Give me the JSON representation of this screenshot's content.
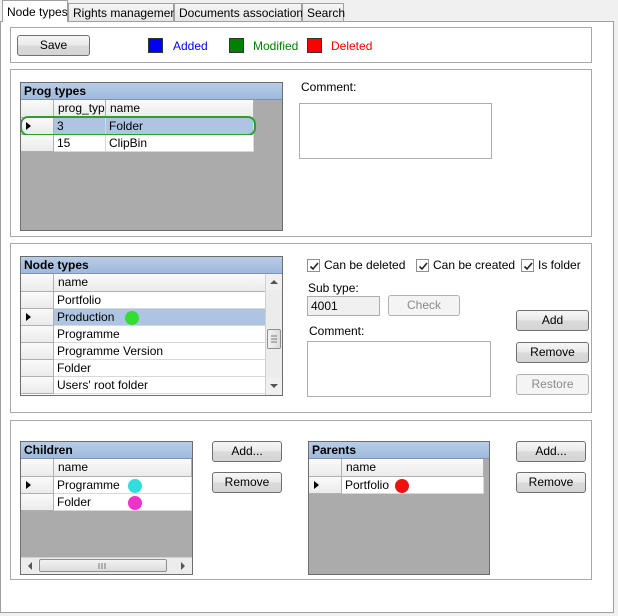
{
  "tabs": [
    {
      "label": "Node types"
    },
    {
      "label": "Rights management"
    },
    {
      "label": "Documents associations"
    },
    {
      "label": "Search"
    }
  ],
  "toolbar": {
    "save_label": "Save",
    "legend": [
      {
        "label": "Added",
        "color": "#0000ff"
      },
      {
        "label": "Modified",
        "color": "#008000"
      },
      {
        "label": "Deleted",
        "color": "#ff0000"
      }
    ]
  },
  "prog_types": {
    "caption": "Prog types",
    "columns": [
      "prog_typ",
      "name"
    ],
    "rows": [
      {
        "prog_typ": "3",
        "name": "Folder"
      },
      {
        "prog_typ": "15",
        "name": "ClipBin"
      }
    ],
    "comment_label": "Comment:"
  },
  "node_types": {
    "caption": "Node types",
    "column": "name",
    "rows": [
      "Portfolio",
      "Production",
      "Programme",
      "Programme Version",
      "Folder",
      "Users' root folder"
    ],
    "status_dot_color": "#33dd33",
    "can_be_deleted_label": "Can be deleted",
    "can_be_created_label": "Can be created",
    "is_folder_label": "Is folder",
    "sub_type_label": "Sub type:",
    "sub_type_value": "4001",
    "check_label": "Check",
    "comment_label": "Comment:",
    "add_label": "Add",
    "remove_label": "Remove",
    "restore_label": "Restore"
  },
  "children": {
    "caption": "Children",
    "column": "name",
    "rows": [
      {
        "name": "Programme",
        "dot_color": "#33dddd"
      },
      {
        "name": "Folder",
        "dot_color": "#ee33cc"
      }
    ],
    "add_label": "Add...",
    "remove_label": "Remove"
  },
  "parents": {
    "caption": "Parents",
    "column": "name",
    "rows": [
      {
        "name": "Portfolio",
        "dot_color": "#ee1111"
      }
    ],
    "add_label": "Add...",
    "remove_label": "Remove"
  }
}
